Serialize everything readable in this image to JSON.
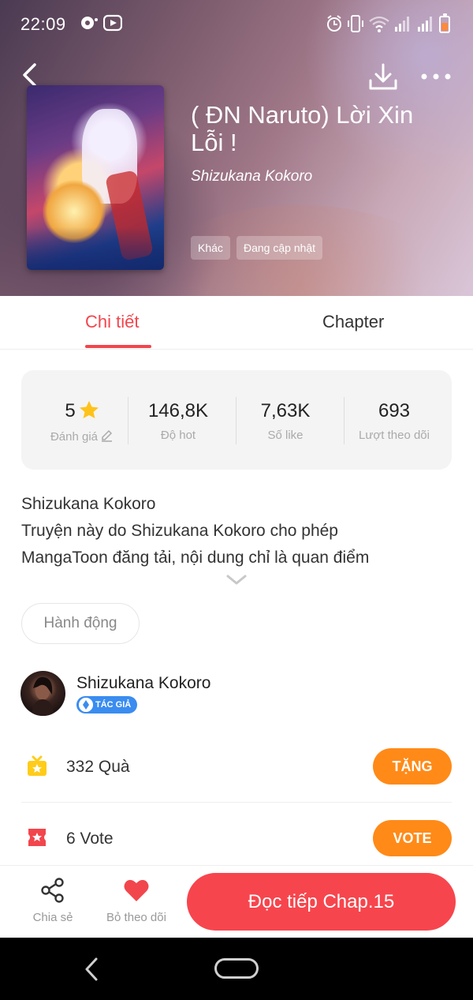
{
  "status_bar": {
    "time": "22:09"
  },
  "story": {
    "title": "( ĐN Naruto) Lời Xin Lỗi !",
    "author": "Shizukana Kokoro",
    "tags": [
      "Khác",
      "Đang cập nhật"
    ]
  },
  "tabs": [
    {
      "label": "Chi tiết"
    },
    {
      "label": "Chapter"
    }
  ],
  "stats": [
    {
      "value": "5",
      "label": "Đánh giá"
    },
    {
      "value": "146,8K",
      "label": "Độ hot"
    },
    {
      "value": "7,63K",
      "label": "Số like"
    },
    {
      "value": "693",
      "label": "Lượt theo dõi"
    }
  ],
  "description": {
    "lines": [
      "Shizukana Kokoro",
      "Truyện này do Shizukana Kokoro cho phép",
      "MangaToon đăng tải, nội dung chỉ là quan điểm"
    ]
  },
  "action_button": "Hành động",
  "author_card": {
    "name": "Shizukana Kokoro",
    "badge": "TÁC GIẢ"
  },
  "gift": {
    "count": "332",
    "unit": "Quà",
    "button": "TẶNG"
  },
  "vote": {
    "count": "6",
    "unit": "Vote",
    "button": "VOTE"
  },
  "bottom_bar": {
    "share": "Chia sẻ",
    "unfollow": "Bỏ theo dõi",
    "read": "Đọc tiếp Chap.15"
  },
  "colors": {
    "accent": "#f2464d",
    "orange": "#ff8a18",
    "badge_blue": "#3a8cf0",
    "gift_yellow": "#ffcc1a",
    "vote_red": "#f2464d"
  }
}
